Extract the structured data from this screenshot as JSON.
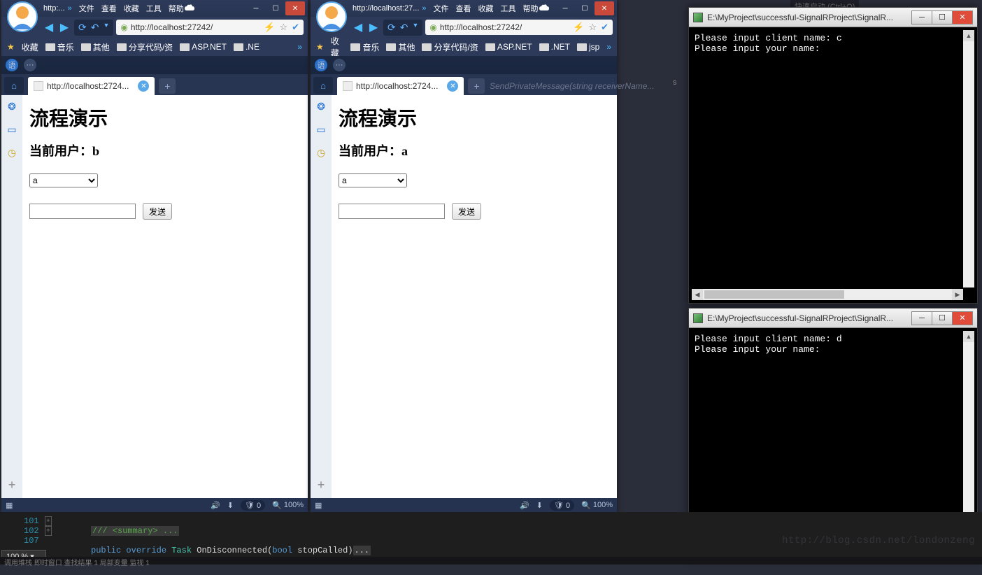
{
  "quicklaunch": "快速启动 (Ctrl+Q)",
  "browsers": [
    {
      "title": "http:...",
      "menus": [
        "文件",
        "查看",
        "收藏",
        "工具",
        "帮助"
      ],
      "address": "http://localhost:27242/",
      "bookmarks_label": "收藏",
      "bookmarks": [
        "音乐",
        "其他",
        "分享代码/资",
        "ASP.NET",
        ".NE"
      ],
      "tab_label": "http://localhost:2724...",
      "page": {
        "heading": "流程演示",
        "current_user_label": "当前用户：",
        "current_user": "b",
        "select_value": "a",
        "send_button": "发送"
      },
      "status": {
        "shield": "0",
        "zoom": "100%"
      }
    },
    {
      "title": "http://localhost:27...",
      "menus": [
        "文件",
        "查看",
        "收藏",
        "工具",
        "帮助"
      ],
      "address": "http://localhost:27242/",
      "bookmarks_label": "收藏",
      "bookmarks": [
        "音乐",
        "其他",
        "分享代码/资",
        "ASP.NET",
        ".NET",
        "jsp"
      ],
      "tab_label": "http://localhost:2724...",
      "page": {
        "heading": "流程演示",
        "current_user_label": "当前用户：",
        "current_user": "a",
        "select_value": "a",
        "send_button": "发送"
      },
      "status": {
        "shield": "0",
        "zoom": "100%"
      }
    }
  ],
  "consoles": [
    {
      "title": "E:\\MyProject\\successful-SignalRProject\\SignalR...",
      "lines": "Please input client name: c\nPlease input your name:"
    },
    {
      "title": "E:\\MyProject\\successful-SignalRProject\\SignalR...",
      "lines": "Please input client name: d\nPlease input your name:"
    }
  ],
  "ide": {
    "line_numbers": [
      "101",
      "102",
      "107"
    ],
    "comment": "/// <summary> ...",
    "code_prefix_kw1": "public",
    "code_prefix_kw2": "override",
    "code_type": "Task",
    "code_method": "OnDisconnected",
    "code_param_kw": "bool",
    "code_param_name": "stopCalled",
    "zoom": "100 %",
    "statusbar": "调用堆栈   即时窗口   查找结果 1   局部变量   监视 1"
  },
  "tab_hint": "SendPrivateMessage(string receiverName...",
  "side_letter": "s",
  "watermark": "http://blog.csdn.net/londonzeng"
}
